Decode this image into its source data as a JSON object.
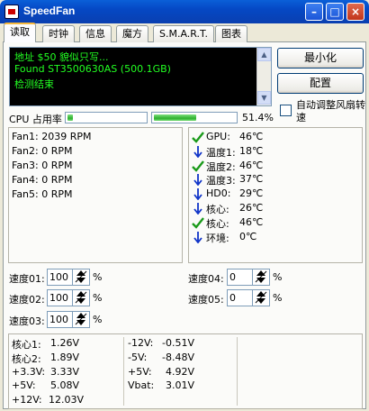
{
  "window": {
    "title": "SpeedFan"
  },
  "tabs": [
    {
      "label": "读取"
    },
    {
      "label": "时钟"
    },
    {
      "label": "信息"
    },
    {
      "label": "魔方"
    },
    {
      "label": "S.M.A.R.T."
    },
    {
      "label": "图表"
    }
  ],
  "log": {
    "lines": [
      "地址 $50 貌似只写...",
      "Found ST3500630AS (500.1GB)",
      "检测结束"
    ]
  },
  "buttons": {
    "minimize": "最小化",
    "config": "配置"
  },
  "auto_fan": {
    "label": "自动调整风扇转速",
    "checked": false
  },
  "cpu": {
    "label": "CPU 占用率",
    "value": "51.4%",
    "fraction": 0.514
  },
  "fans": [
    {
      "label": "Fan1: 2039 RPM"
    },
    {
      "label": "Fan2: 0 RPM"
    },
    {
      "label": "Fan3: 0 RPM"
    },
    {
      "label": "Fan4: 0 RPM"
    },
    {
      "label": "Fan5: 0 RPM"
    }
  ],
  "temps": [
    {
      "label": "GPU:",
      "value": "46℃",
      "icon": "check-icon"
    },
    {
      "label": "温度1:",
      "value": "18℃",
      "icon": "arrow-down-icon"
    },
    {
      "label": "温度2:",
      "value": "46℃",
      "icon": "check-icon"
    },
    {
      "label": "温度3:",
      "value": "37℃",
      "icon": "arrow-down-icon"
    },
    {
      "label": "HD0:",
      "value": "29℃",
      "icon": "arrow-down-icon"
    },
    {
      "label": "核心:",
      "value": "26℃",
      "icon": "arrow-down-icon"
    },
    {
      "label": "核心:",
      "value": "46℃",
      "icon": "check-icon"
    },
    {
      "label": "环境:",
      "value": "0℃",
      "icon": "arrow-down-icon"
    }
  ],
  "speeds_left": [
    {
      "label": "速度01:",
      "value": "100",
      "unit": "%"
    },
    {
      "label": "速度02:",
      "value": "100",
      "unit": "%"
    },
    {
      "label": "速度03:",
      "value": "100",
      "unit": "%"
    }
  ],
  "speeds_right": [
    {
      "label": "速度04:",
      "value": "0",
      "unit": "%"
    },
    {
      "label": "速度05:",
      "value": "0",
      "unit": "%"
    }
  ],
  "voltages_col1": [
    {
      "label": "核心1:",
      "value": "1.26V"
    },
    {
      "label": "核心2:",
      "value": "1.89V"
    },
    {
      "label": "+3.3V:",
      "value": "3.33V"
    },
    {
      "label": "+5V:",
      "value": "5.08V"
    },
    {
      "label": "+12V:",
      "value": "12.03V"
    }
  ],
  "voltages_col2": [
    {
      "label": "-12V:",
      "value": "-0.51V"
    },
    {
      "label": "-5V:",
      "value": "-8.48V"
    },
    {
      "label": "+5V:",
      "value": "4.92V"
    },
    {
      "label": "Vbat:",
      "value": "3.01V"
    }
  ],
  "colors": {
    "log_text": "#22ff22",
    "check": "#1a9a1a",
    "arrow": "#1034c8",
    "titlebar": "#0548c4"
  }
}
